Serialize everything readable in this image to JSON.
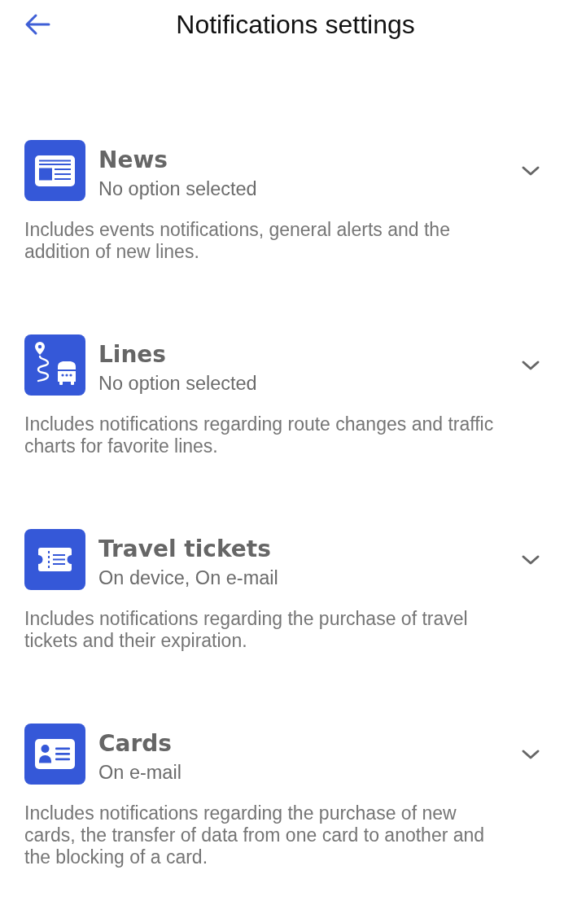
{
  "header": {
    "title": "Notifications settings"
  },
  "sections": [
    {
      "title": "News",
      "status": "No option selected",
      "description": "Includes events notifications, general alerts and the addition of new lines.",
      "expanded": false
    },
    {
      "title": "Lines",
      "status": "No option selected",
      "description": "Includes notifications regarding route changes and traffic charts for favorite lines.",
      "expanded": false
    },
    {
      "title": "Travel tickets",
      "status": "On device, On e-mail",
      "description": "Includes notifications regarding the purchase of travel tickets and their expiration.",
      "expanded": false
    },
    {
      "title": "Cards",
      "status": "On e-mail",
      "description": "Includes notifications regarding the purchase of new cards, the transfer of data from one card to another and the blocking of a card.",
      "expanded": false
    }
  ]
}
